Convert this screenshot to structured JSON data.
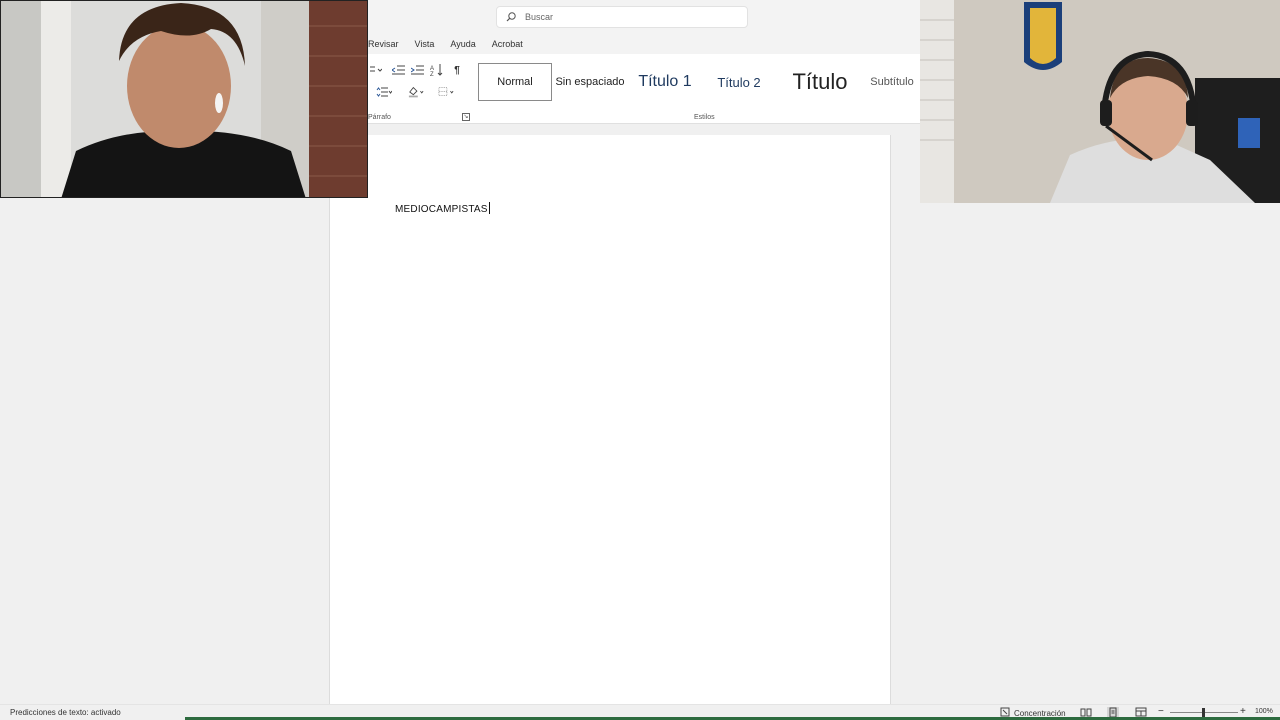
{
  "search": {
    "placeholder": "Buscar",
    "icon": "search-icon"
  },
  "menu": {
    "tabs": [
      "Revisar",
      "Vista",
      "Ayuda",
      "Acrobat"
    ]
  },
  "ribbon": {
    "paragraph": {
      "label": "Párrafo",
      "tools": [
        "multilevel-list-icon",
        "decrease-indent-icon",
        "increase-indent-icon",
        "sort-icon",
        "pilcrow-icon",
        "line-spacing-icon",
        "shading-icon",
        "borders-icon"
      ]
    },
    "styles": {
      "label": "Estilos",
      "items": [
        "Normal",
        "Sin espaciado",
        "Título 1",
        "Título 2",
        "Título",
        "Subtítulo"
      ]
    }
  },
  "document": {
    "text": "MEDIOCAMPISTAS"
  },
  "status": {
    "left": "Predicciones de texto: activado",
    "focus": "Concentración",
    "zoom": "100%"
  },
  "colors": {
    "accent_bottom": "#2d6b3f",
    "heading": "#1f3a5f"
  }
}
